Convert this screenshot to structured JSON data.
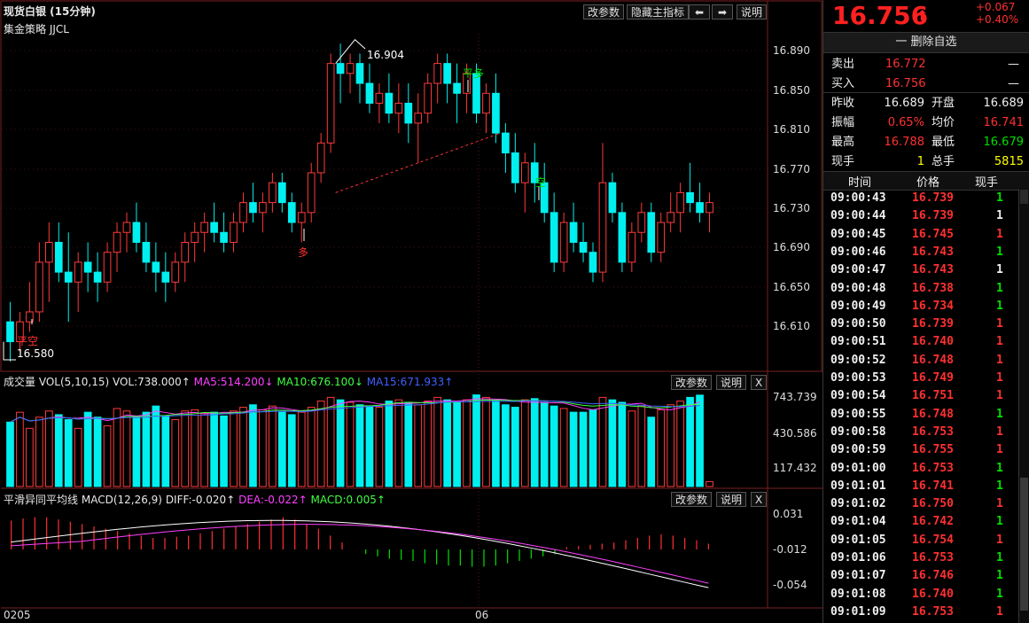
{
  "header": {
    "title": "现货白银 (15分钟)",
    "subtitle": "集金策略 JJCL",
    "buttons": [
      "改参数",
      "隐藏主指标",
      "说明"
    ],
    "arrow_left": "⬅",
    "arrow_right": "➡"
  },
  "main_chart": {
    "y_ticks": [
      "16.890",
      "16.850",
      "16.810",
      "16.770",
      "16.730",
      "16.690",
      "16.650",
      "16.610"
    ],
    "high_label": "16.904",
    "low_label": "16.580",
    "annotations": {
      "ping_kong": "平空",
      "duo": "多",
      "ping_duo": "平多",
      "kong": "空"
    },
    "colors": {
      "up": "#ff3a3a",
      "down": "#00f0f0",
      "signal_red": "#ff3030",
      "signal_green": "#00e000"
    }
  },
  "volume_panel": {
    "title": "成交量",
    "legend": "VOL(5,10,15)",
    "vol": "VOL:738.000↑",
    "ma5": "MA5:514.200↓",
    "ma10": "MA10:676.100↓",
    "ma15": "MA15:671.933↑",
    "y_ticks": [
      "743.739",
      "430.586",
      "117.432"
    ],
    "buttons": [
      "改参数",
      "说明",
      "X"
    ]
  },
  "macd_panel": {
    "title": "平滑异同平均线",
    "legend": "MACD(12,26,9)",
    "diff": "DIFF:-0.020↑",
    "dea": "DEA:-0.022↑",
    "macd": "MACD:0.005↑",
    "y_ticks": [
      "0.031",
      "-0.012",
      "-0.054"
    ],
    "buttons": [
      "改参数",
      "说明",
      "X"
    ]
  },
  "x_axis": {
    "labels": [
      "0205",
      "06"
    ]
  },
  "chart_data": {
    "type": "candlestick",
    "series": [
      {
        "name": "现货白银",
        "ohlc": [
          [
            16.62,
            16.64,
            16.58,
            16.6
          ],
          [
            16.6,
            16.63,
            16.59,
            16.62
          ],
          [
            16.62,
            16.66,
            16.61,
            16.63
          ],
          [
            16.63,
            16.7,
            16.62,
            16.68
          ],
          [
            16.68,
            16.72,
            16.64,
            16.7
          ],
          [
            16.7,
            16.72,
            16.66,
            16.67
          ],
          [
            16.67,
            16.71,
            16.62,
            16.66
          ],
          [
            16.66,
            16.69,
            16.63,
            16.68
          ],
          [
            16.68,
            16.7,
            16.65,
            16.67
          ],
          [
            16.67,
            16.69,
            16.64,
            16.66
          ],
          [
            16.66,
            16.7,
            16.65,
            16.69
          ],
          [
            16.69,
            16.72,
            16.67,
            16.71
          ],
          [
            16.71,
            16.73,
            16.69,
            16.72
          ],
          [
            16.72,
            16.74,
            16.69,
            16.7
          ],
          [
            16.7,
            16.72,
            16.67,
            16.68
          ],
          [
            16.68,
            16.7,
            16.65,
            16.67
          ],
          [
            16.67,
            16.69,
            16.64,
            16.66
          ],
          [
            16.66,
            16.69,
            16.65,
            16.68
          ],
          [
            16.68,
            16.71,
            16.66,
            16.7
          ],
          [
            16.7,
            16.72,
            16.68,
            16.71
          ],
          [
            16.71,
            16.73,
            16.69,
            16.72
          ],
          [
            16.72,
            16.74,
            16.7,
            16.71
          ],
          [
            16.71,
            16.73,
            16.69,
            16.7
          ],
          [
            16.7,
            16.73,
            16.69,
            16.72
          ],
          [
            16.72,
            16.75,
            16.71,
            16.74
          ],
          [
            16.74,
            16.76,
            16.72,
            16.73
          ],
          [
            16.73,
            16.75,
            16.71,
            16.74
          ],
          [
            16.74,
            16.77,
            16.73,
            16.76
          ],
          [
            16.76,
            16.77,
            16.73,
            16.74
          ],
          [
            16.74,
            16.75,
            16.71,
            16.72
          ],
          [
            16.72,
            16.74,
            16.7,
            16.73
          ],
          [
            16.73,
            16.78,
            16.72,
            16.77
          ],
          [
            16.77,
            16.81,
            16.76,
            16.8
          ],
          [
            16.8,
            16.89,
            16.79,
            16.88
          ],
          [
            16.88,
            16.9,
            16.84,
            16.87
          ],
          [
            16.87,
            16.89,
            16.85,
            16.88
          ],
          [
            16.88,
            16.89,
            16.84,
            16.86
          ],
          [
            16.86,
            16.88,
            16.83,
            16.84
          ],
          [
            16.84,
            16.86,
            16.82,
            16.85
          ],
          [
            16.85,
            16.87,
            16.82,
            16.83
          ],
          [
            16.83,
            16.86,
            16.81,
            16.84
          ],
          [
            16.84,
            16.86,
            16.8,
            16.82
          ],
          [
            16.82,
            16.85,
            16.78,
            16.83
          ],
          [
            16.83,
            16.87,
            16.82,
            16.86
          ],
          [
            16.86,
            16.89,
            16.84,
            16.88
          ],
          [
            16.88,
            16.89,
            16.84,
            16.86
          ],
          [
            16.86,
            16.88,
            16.82,
            16.85
          ],
          [
            16.85,
            16.88,
            16.83,
            16.87
          ],
          [
            16.87,
            16.88,
            16.82,
            16.83
          ],
          [
            16.83,
            16.86,
            16.81,
            16.85
          ],
          [
            16.85,
            16.87,
            16.8,
            16.81
          ],
          [
            16.81,
            16.82,
            16.77,
            16.79
          ],
          [
            16.79,
            16.81,
            16.75,
            16.76
          ],
          [
            16.76,
            16.79,
            16.73,
            16.78
          ],
          [
            16.78,
            16.8,
            16.74,
            16.76
          ],
          [
            16.76,
            16.78,
            16.72,
            16.73
          ],
          [
            16.73,
            16.75,
            16.67,
            16.68
          ],
          [
            16.68,
            16.73,
            16.67,
            16.72
          ],
          [
            16.72,
            16.74,
            16.69,
            16.7
          ],
          [
            16.7,
            16.72,
            16.68,
            16.69
          ],
          [
            16.69,
            16.7,
            16.66,
            16.67
          ],
          [
            16.67,
            16.8,
            16.66,
            16.76
          ],
          [
            16.76,
            16.77,
            16.72,
            16.73
          ],
          [
            16.73,
            16.74,
            16.67,
            16.68
          ],
          [
            16.68,
            16.72,
            16.67,
            16.71
          ],
          [
            16.71,
            16.74,
            16.7,
            16.73
          ],
          [
            16.73,
            16.74,
            16.68,
            16.69
          ],
          [
            16.69,
            16.73,
            16.68,
            16.72
          ],
          [
            16.72,
            16.75,
            16.71,
            16.73
          ],
          [
            16.73,
            16.76,
            16.71,
            16.75
          ],
          [
            16.75,
            16.78,
            16.73,
            16.74
          ],
          [
            16.74,
            16.76,
            16.72,
            16.73
          ],
          [
            16.73,
            16.75,
            16.71,
            16.74
          ]
        ]
      }
    ],
    "volume": [
      520,
      600,
      470,
      560,
      610,
      580,
      540,
      470,
      600,
      560,
      490,
      630,
      610,
      560,
      600,
      650,
      570,
      540,
      610,
      620,
      590,
      600,
      570,
      610,
      640,
      660,
      620,
      650,
      600,
      580,
      600,
      640,
      690,
      720,
      700,
      680,
      660,
      650,
      640,
      690,
      700,
      680,
      660,
      690,
      720,
      700,
      680,
      700,
      740,
      720,
      690,
      660,
      640,
      700,
      710,
      680,
      650,
      630,
      600,
      600,
      620,
      720,
      700,
      680,
      610,
      650,
      560,
      620,
      660,
      690,
      720,
      738,
      40
    ],
    "macd_hist": [
      0.025,
      0.027,
      0.028,
      0.028,
      0.026,
      0.024,
      0.022,
      0.02,
      0.018,
      0.016,
      0.014,
      0.012,
      0.01,
      0.01,
      0.011,
      0.012,
      0.014,
      0.016,
      0.018,
      0.02,
      0.022,
      0.024,
      0.026,
      0.028,
      0.026,
      0.022,
      0.018,
      0.012,
      0.006,
      0.0,
      -0.004,
      -0.006,
      -0.008,
      -0.009,
      -0.01,
      -0.012,
      -0.013,
      -0.014,
      -0.014,
      -0.015,
      -0.015,
      -0.014,
      -0.012,
      -0.01,
      -0.008,
      -0.006,
      -0.004,
      0.002,
      0.003,
      0.004,
      0.005,
      0.006,
      0.008,
      0.01,
      0.012,
      0.013,
      0.012,
      0.01,
      0.008,
      0.005
    ],
    "y_range": [
      16.58,
      16.91
    ]
  },
  "quote_panel": {
    "price": "16.756",
    "arrow": "⬆",
    "change": "+0.067",
    "change_pct": "+0.40%",
    "watch_button": "一 删除自选",
    "sell_label": "卖出",
    "sell_price": "16.772",
    "sell_qty": "—",
    "buy_label": "买入",
    "buy_price": "16.756",
    "buy_qty": "—",
    "stats": [
      {
        "l1": "昨收",
        "v1": "16.689",
        "c1": "white",
        "l2": "开盘",
        "v2": "16.689",
        "c2": "white"
      },
      {
        "l1": "振幅",
        "v1": "0.65%",
        "c1": "red",
        "l2": "均价",
        "v2": "16.741",
        "c2": "red"
      },
      {
        "l1": "最高",
        "v1": "16.788",
        "c1": "red",
        "l2": "最低",
        "v2": "16.679",
        "c2": "green"
      },
      {
        "l1": "现手",
        "v1": "1",
        "c1": "yellow",
        "l2": "总手",
        "v2": "5815",
        "c2": "yellow"
      }
    ],
    "tick_headers": [
      "时间",
      "价格",
      "现手"
    ],
    "ticks": [
      {
        "t": "09:00:43",
        "p": "16.739",
        "q": "1",
        "qc": "green"
      },
      {
        "t": "09:00:44",
        "p": "16.739",
        "q": "1",
        "qc": "white"
      },
      {
        "t": "09:00:45",
        "p": "16.745",
        "q": "1",
        "qc": "red"
      },
      {
        "t": "09:00:46",
        "p": "16.743",
        "q": "1",
        "qc": "green"
      },
      {
        "t": "09:00:47",
        "p": "16.743",
        "q": "1",
        "qc": "white"
      },
      {
        "t": "09:00:48",
        "p": "16.738",
        "q": "1",
        "qc": "green"
      },
      {
        "t": "09:00:49",
        "p": "16.734",
        "q": "1",
        "qc": "green"
      },
      {
        "t": "09:00:50",
        "p": "16.739",
        "q": "1",
        "qc": "red"
      },
      {
        "t": "09:00:51",
        "p": "16.740",
        "q": "1",
        "qc": "red"
      },
      {
        "t": "09:00:52",
        "p": "16.748",
        "q": "1",
        "qc": "red"
      },
      {
        "t": "09:00:53",
        "p": "16.749",
        "q": "1",
        "qc": "red"
      },
      {
        "t": "09:00:54",
        "p": "16.751",
        "q": "1",
        "qc": "red"
      },
      {
        "t": "09:00:55",
        "p": "16.748",
        "q": "1",
        "qc": "green"
      },
      {
        "t": "09:00:58",
        "p": "16.753",
        "q": "1",
        "qc": "red"
      },
      {
        "t": "09:00:59",
        "p": "16.755",
        "q": "1",
        "qc": "red"
      },
      {
        "t": "09:01:00",
        "p": "16.753",
        "q": "1",
        "qc": "green"
      },
      {
        "t": "09:01:01",
        "p": "16.741",
        "q": "1",
        "qc": "green"
      },
      {
        "t": "09:01:02",
        "p": "16.750",
        "q": "1",
        "qc": "red"
      },
      {
        "t": "09:01:04",
        "p": "16.742",
        "q": "1",
        "qc": "green"
      },
      {
        "t": "09:01:05",
        "p": "16.754",
        "q": "1",
        "qc": "red"
      },
      {
        "t": "09:01:06",
        "p": "16.753",
        "q": "1",
        "qc": "green"
      },
      {
        "t": "09:01:07",
        "p": "16.746",
        "q": "1",
        "qc": "green"
      },
      {
        "t": "09:01:08",
        "p": "16.740",
        "q": "1",
        "qc": "green"
      },
      {
        "t": "09:01:09",
        "p": "16.753",
        "q": "1",
        "qc": "red"
      }
    ]
  }
}
